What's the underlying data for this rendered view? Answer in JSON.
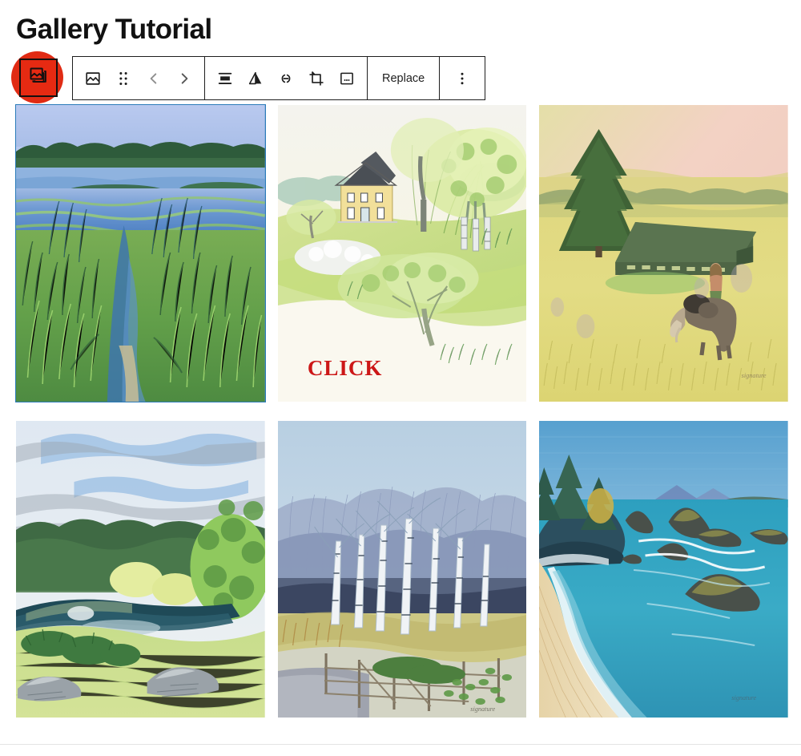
{
  "header": {
    "title": "Gallery Tutorial"
  },
  "block_toolbar": {
    "block_type_button": {
      "icon": "gallery-icon",
      "label": "Gallery",
      "selected": true,
      "highlight_color": "#e02b14",
      "icon_button_bg": "#e62a12"
    },
    "groups": [
      {
        "name": "block-controls",
        "items": [
          {
            "name": "image-block-icon",
            "icon": "image-icon",
            "label": "Image"
          },
          {
            "name": "drag-handle",
            "icon": "drag-dots-icon",
            "label": "Drag"
          },
          {
            "name": "move-up",
            "icon": "chevron-left-icon",
            "label": "Move left",
            "disabled": true
          },
          {
            "name": "move-down",
            "icon": "chevron-right-icon",
            "label": "Move right",
            "disabled": true
          }
        ]
      },
      {
        "name": "format-controls",
        "items": [
          {
            "name": "align-button",
            "icon": "align-icon",
            "label": "Align"
          },
          {
            "name": "duotone-button",
            "icon": "duotone-triangle-icon",
            "label": "Apply duotone filter"
          },
          {
            "name": "link-button",
            "icon": "link-icon",
            "label": "Link"
          },
          {
            "name": "crop-button",
            "icon": "crop-icon",
            "label": "Crop"
          },
          {
            "name": "caption-button",
            "icon": "caption-icon",
            "label": "Add caption"
          }
        ]
      },
      {
        "name": "replace-group",
        "items": [
          {
            "name": "replace-button",
            "icon": "",
            "label": "Replace"
          }
        ]
      },
      {
        "name": "options-group",
        "items": [
          {
            "name": "more-options-button",
            "icon": "vertical-dots-icon",
            "label": "Options"
          }
        ]
      }
    ],
    "replace_label": "Replace"
  },
  "gallery": {
    "columns": 3,
    "images": [
      {
        "name": "gallery-image-1",
        "alt": "Marsh grasses and blue lake with treeline",
        "selected": true,
        "overlay_text": ""
      },
      {
        "name": "gallery-image-2",
        "alt": "Spring landscape with yellow house and flowering trees",
        "selected": false,
        "overlay_text": "CLICK"
      },
      {
        "name": "gallery-image-3",
        "alt": "Yellow field with spruce tree, barn, person and dog",
        "selected": false,
        "overlay_text": ""
      },
      {
        "name": "gallery-image-4",
        "alt": "Pond with clouds, trees and boulders",
        "selected": false,
        "overlay_text": ""
      },
      {
        "name": "gallery-image-5",
        "alt": "Winter birch grove with fence and path",
        "selected": false,
        "overlay_text": ""
      },
      {
        "name": "gallery-image-6",
        "alt": "Coastal beach with rocks and turquoise water",
        "selected": false,
        "overlay_text": ""
      }
    ]
  },
  "colors": {
    "highlight_red": "#e02b14",
    "selection_blue": "#2b7bb9",
    "click_text_red": "#cc1717",
    "toolbar_border": "#1e1e1e",
    "text": "#1e1e1e"
  }
}
